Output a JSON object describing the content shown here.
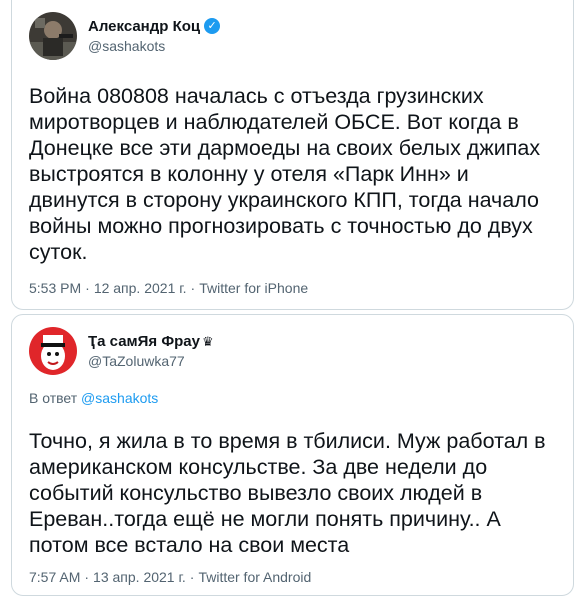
{
  "tweet1": {
    "name": "Александр Коц",
    "handle": "@sashakots",
    "text": "Война 080808 началась с отъезда грузинских\nмиротворцев и наблюдателей ОБСЕ. Вот когда в\nДонецке все эти дармоеды на своих белых джипах\nвыстроятся в колонну у отеля «Парк Инн» и\nдвинутся в сторону украинского КПП, тогда начало\nвойны можно прогнозировать с точностью до двух\nсуток.",
    "time": "5:53 PM",
    "date": "12 апр. 2021 г.",
    "source": "Twitter for iPhone"
  },
  "tweet2": {
    "name": "Ҭа самЯя Фрау",
    "crown": "♛",
    "handle": "@TaZoluwka77",
    "reply_prefix": "В ответ",
    "reply_mention": "@sashakots",
    "text": "Точно, я жила в то время в тбилиси. Муж работал в\nамериканском консульстве. За две недели до\nсобытий консульство вывезло своих людей в\nЕреван..тогда ещё не могли понять причину.. А\nпотом все встало на свои места",
    "time": "7:57 AM",
    "date": "13 апр. 2021 г.",
    "source": "Twitter for Android"
  },
  "separator": "·",
  "colors": {
    "verified": "#1d9bf0",
    "secondary_text": "#536471",
    "border": "#cfd9de"
  }
}
